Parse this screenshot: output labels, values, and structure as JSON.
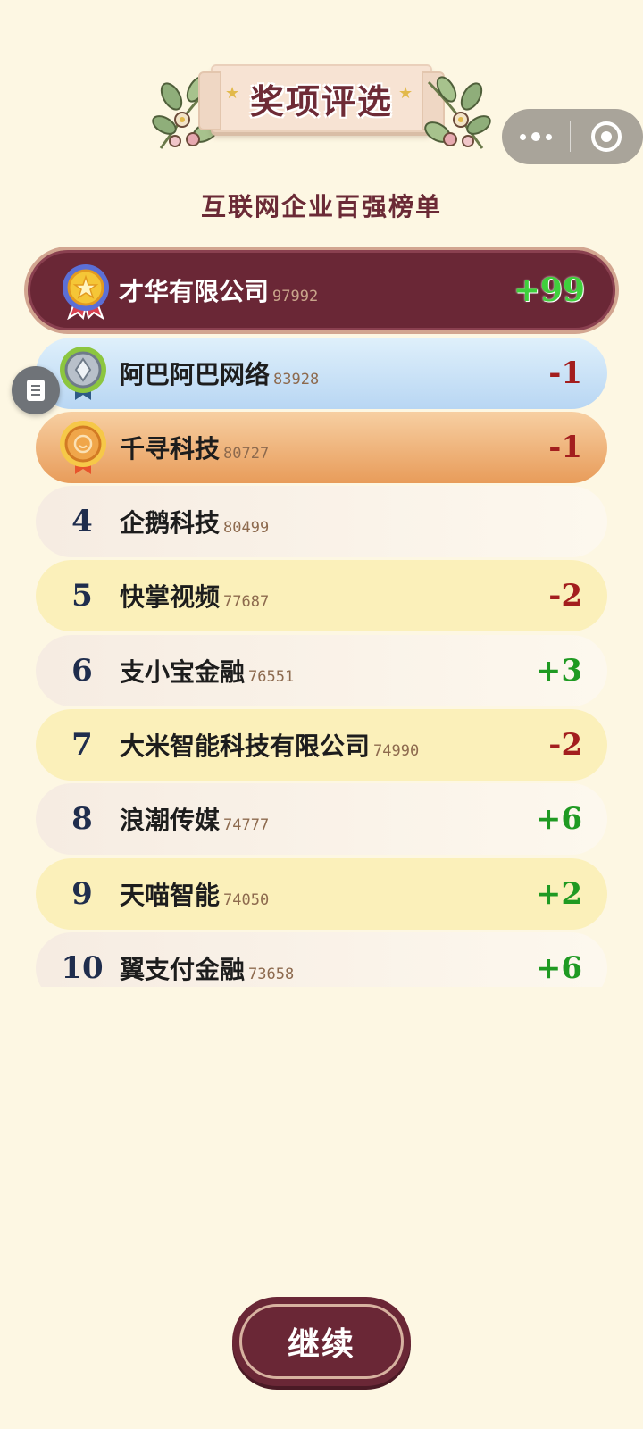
{
  "header": {
    "title": "奖项评选",
    "subtitle": "互联网企业百强榜单"
  },
  "capsule": {
    "more_icon": "more-dots-icon",
    "close_icon": "target-close-icon"
  },
  "float_button": {
    "icon": "document-icon"
  },
  "rankings": [
    {
      "rank": "1",
      "name": "才华有限公司",
      "score": "97992",
      "change": "+99",
      "direction": "up",
      "medal": "gold-star-medal"
    },
    {
      "rank": "2",
      "name": "阿巴阿巴网络",
      "score": "83928",
      "change": "-1",
      "direction": "down",
      "medal": "silver-diamond-medal"
    },
    {
      "rank": "3",
      "name": "千寻科技",
      "score": "80727",
      "change": "-1",
      "direction": "down",
      "medal": "bronze-face-medal"
    },
    {
      "rank": "4",
      "name": "企鹅科技",
      "score": "80499",
      "change": "",
      "direction": "none"
    },
    {
      "rank": "5",
      "name": "快掌视频",
      "score": "77687",
      "change": "-2",
      "direction": "down"
    },
    {
      "rank": "6",
      "name": "支小宝金融",
      "score": "76551",
      "change": "+3",
      "direction": "up"
    },
    {
      "rank": "7",
      "name": "大米智能科技有限公司",
      "score": "74990",
      "change": "-2",
      "direction": "down"
    },
    {
      "rank": "8",
      "name": "浪潮传媒",
      "score": "74777",
      "change": "+6",
      "direction": "up"
    },
    {
      "rank": "9",
      "name": "天喵智能",
      "score": "74050",
      "change": "+2",
      "direction": "up"
    },
    {
      "rank": "10",
      "name": "翼支付金融",
      "score": "73658",
      "change": "+6",
      "direction": "up"
    }
  ],
  "continue_button": {
    "label": "继续"
  },
  "colors": {
    "background": "#fdf7e3",
    "brand": "#6a2736",
    "up": "#1f9a22",
    "down": "#a31e1e"
  }
}
